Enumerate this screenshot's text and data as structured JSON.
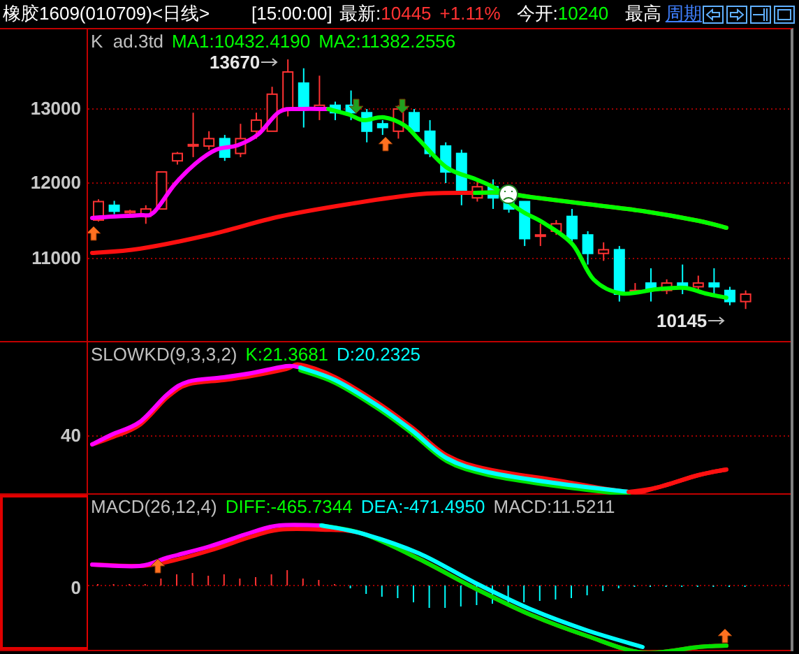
{
  "header": {
    "title": "橡胶1609(010709)<日线>",
    "time": "[15:00:00]",
    "latest_label": "最新:",
    "latest_price": "10445",
    "latest_change": "+1.11%",
    "open_label": "今开:",
    "open_price": "10240",
    "high_label": "最高",
    "period_link": "周期"
  },
  "price_panel": {
    "legend": [
      {
        "text": "K  ad.3td",
        "color": "#c0c0c0"
      },
      {
        "text": "MA1:10432.4190",
        "color": "#00ff00"
      },
      {
        "text": "MA2:11382.2556",
        "color": "#00ff00"
      }
    ],
    "y_labels": [
      "13000",
      "12000",
      "11000"
    ],
    "high_marker": "13670",
    "low_marker": "10145"
  },
  "kd_panel": {
    "legend": [
      {
        "text": "SLOWKD(9,3,3,2)",
        "color": "#c0c0c0"
      },
      {
        "text": "K:21.3681",
        "color": "#00ff00"
      },
      {
        "text": "D:20.2325",
        "color": "#00ffff"
      }
    ],
    "y_labels": [
      "40"
    ]
  },
  "macd_panel": {
    "legend": [
      {
        "text": "MACD(26,12,4)",
        "color": "#c0c0c0"
      },
      {
        "text": "DIFF:-465.7344",
        "color": "#00ff00"
      },
      {
        "text": "DEA:-471.4950",
        "color": "#00ffff"
      },
      {
        "text": "MACD:11.5211",
        "color": "#c0c0c0"
      }
    ],
    "y_labels": [
      "0"
    ]
  }
}
